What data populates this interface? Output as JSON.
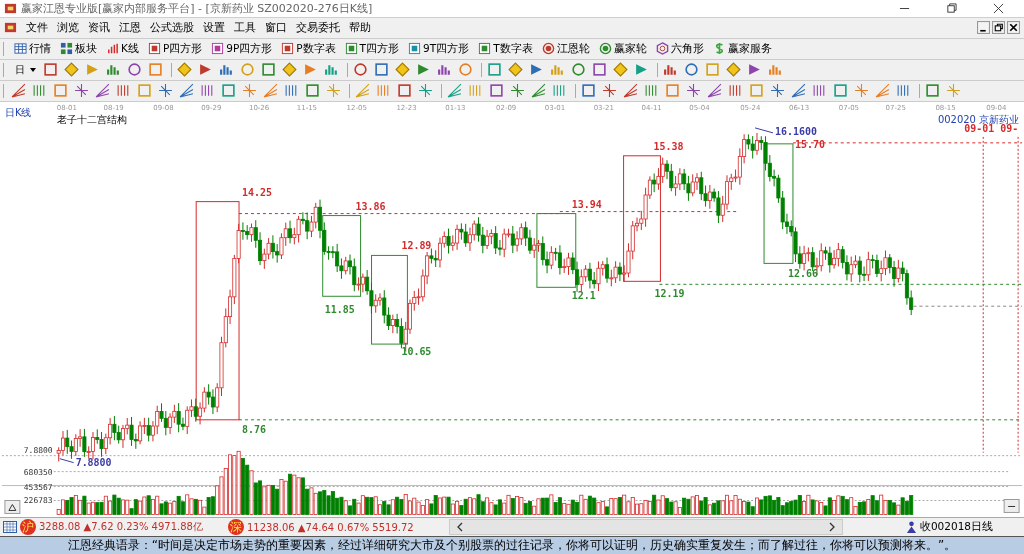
{
  "window": {
    "title": "赢家江恩专业版[赢家内部服务平台] - [京新药业  SZ002020-276日K线]"
  },
  "menu": {
    "items": [
      "文件",
      "浏览",
      "资讯",
      "江恩",
      "公式选股",
      "设置",
      "工具",
      "窗口",
      "交易委托",
      "帮助"
    ]
  },
  "toolbar": {
    "items": [
      "行情",
      "板块",
      "K线",
      "P四方形",
      "9P四方形",
      "P数字表",
      "T四方形",
      "9T四方形",
      "T数字表",
      "江恩轮",
      "赢家轮",
      "六角形",
      "赢家服务"
    ]
  },
  "period_selector": {
    "label": "日"
  },
  "chart": {
    "period": "日K线",
    "title": "老子十二宫结构",
    "stock": "002020 京新药业",
    "dates": [
      "08-01",
      "08-19",
      "09-08",
      "09-29",
      "10-26",
      "11-15",
      "12-05",
      "12-23",
      "01-13",
      "02-09",
      "03-01",
      "03-21",
      "04-11",
      "05-04",
      "05-24",
      "06-13",
      "07-05",
      "07-25",
      "08-15",
      "09-04"
    ],
    "price_axis_label": "7.8800",
    "annotations": [
      {
        "text": "14.25",
        "color": "#d42a2a"
      },
      {
        "text": "8.76",
        "color": "#2e8b2e"
      },
      {
        "text": "13.86",
        "color": "#d42a2a"
      },
      {
        "text": "11.85",
        "color": "#2e8b2e"
      },
      {
        "text": "12.89",
        "color": "#d42a2a"
      },
      {
        "text": "10.65",
        "color": "#2e8b2e"
      },
      {
        "text": "13.94",
        "color": "#d42a2a"
      },
      {
        "text": "12.1",
        "color": "#2e8b2e"
      },
      {
        "text": "12.19",
        "color": "#2e8b2e"
      },
      {
        "text": "15.38",
        "color": "#d42a2a"
      },
      {
        "text": "16.1600",
        "color": "#3a3aa8"
      },
      {
        "text": "15.70",
        "color": "#d42a2a"
      },
      {
        "text": "12.66",
        "color": "#2e8b2e"
      },
      {
        "text": "09-01",
        "color": "#d42a2a"
      },
      {
        "text": "09-",
        "color": "#d42a2a"
      },
      {
        "text": "7.8800",
        "color": "#3a3aa8"
      }
    ],
    "volume_axis": [
      "680350",
      "453567",
      "226783"
    ]
  },
  "status_bar": {
    "indices": [
      {
        "badge": "沪",
        "text": "3288.08 ▲7.62 0.23% 4971.88亿"
      },
      {
        "badge": "深",
        "text": "11238.06 ▲74.64 0.67% 5519.72"
      }
    ],
    "right": "收002018日线"
  },
  "quote": "江恩经典语录：“时间是决定市场走势的重要因素，经过详细研究大市及个别股票的过往记录，你将可以证明，历史确实重复发生；而了解过往，你将可以预测将来。”。"
}
